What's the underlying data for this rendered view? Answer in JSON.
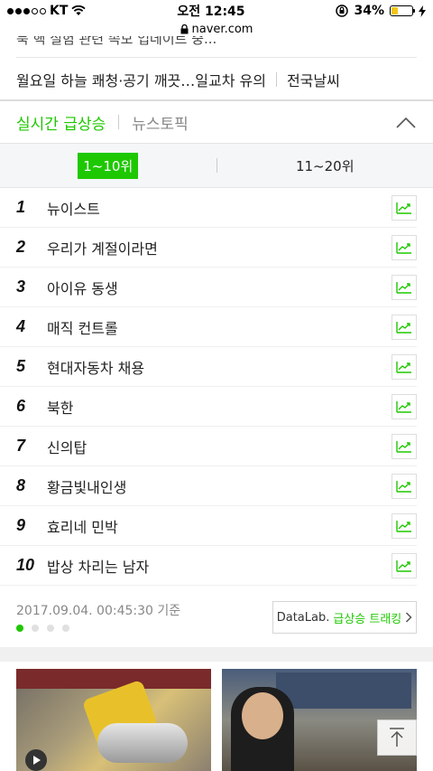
{
  "status_bar": {
    "carrier": "KT",
    "time": "오전 12:45",
    "battery": "34%",
    "battery_level": 0.34
  },
  "url_bar": {
    "domain": "naver.com"
  },
  "news_strip": {
    "cut_text": "북 핵 실험 관련 속보 업데이트 중...",
    "headline": "월요일 하늘 쾌청·공기 깨끗…일교차 유의",
    "link": "전국날씨"
  },
  "tabs": {
    "active": "실시간 급상승",
    "inactive": "뉴스토픽"
  },
  "range": {
    "active": "1~10위",
    "inactive": "11~20위"
  },
  "ranking": [
    {
      "rank": "1",
      "keyword": "뉴이스트"
    },
    {
      "rank": "2",
      "keyword": "우리가 계절이라면"
    },
    {
      "rank": "3",
      "keyword": "아이유 동생"
    },
    {
      "rank": "4",
      "keyword": "매직 컨트롤"
    },
    {
      "rank": "5",
      "keyword": "현대자동차 채용"
    },
    {
      "rank": "6",
      "keyword": "북한"
    },
    {
      "rank": "7",
      "keyword": "신의탑"
    },
    {
      "rank": "8",
      "keyword": "황금빛내인생"
    },
    {
      "rank": "9",
      "keyword": "효리네 민박"
    },
    {
      "rank": "10",
      "keyword": "밥상 차리는 남자"
    }
  ],
  "footer": {
    "timestamp": "2017.09.04. 00:45:30 기준",
    "datalab_prefix": "DataLab.",
    "datalab_suffix": "급상승 트래킹",
    "pager_active_index": 0,
    "pager_count": 4
  },
  "colors": {
    "accent": "#1ec800",
    "battery": "#f5c518"
  }
}
